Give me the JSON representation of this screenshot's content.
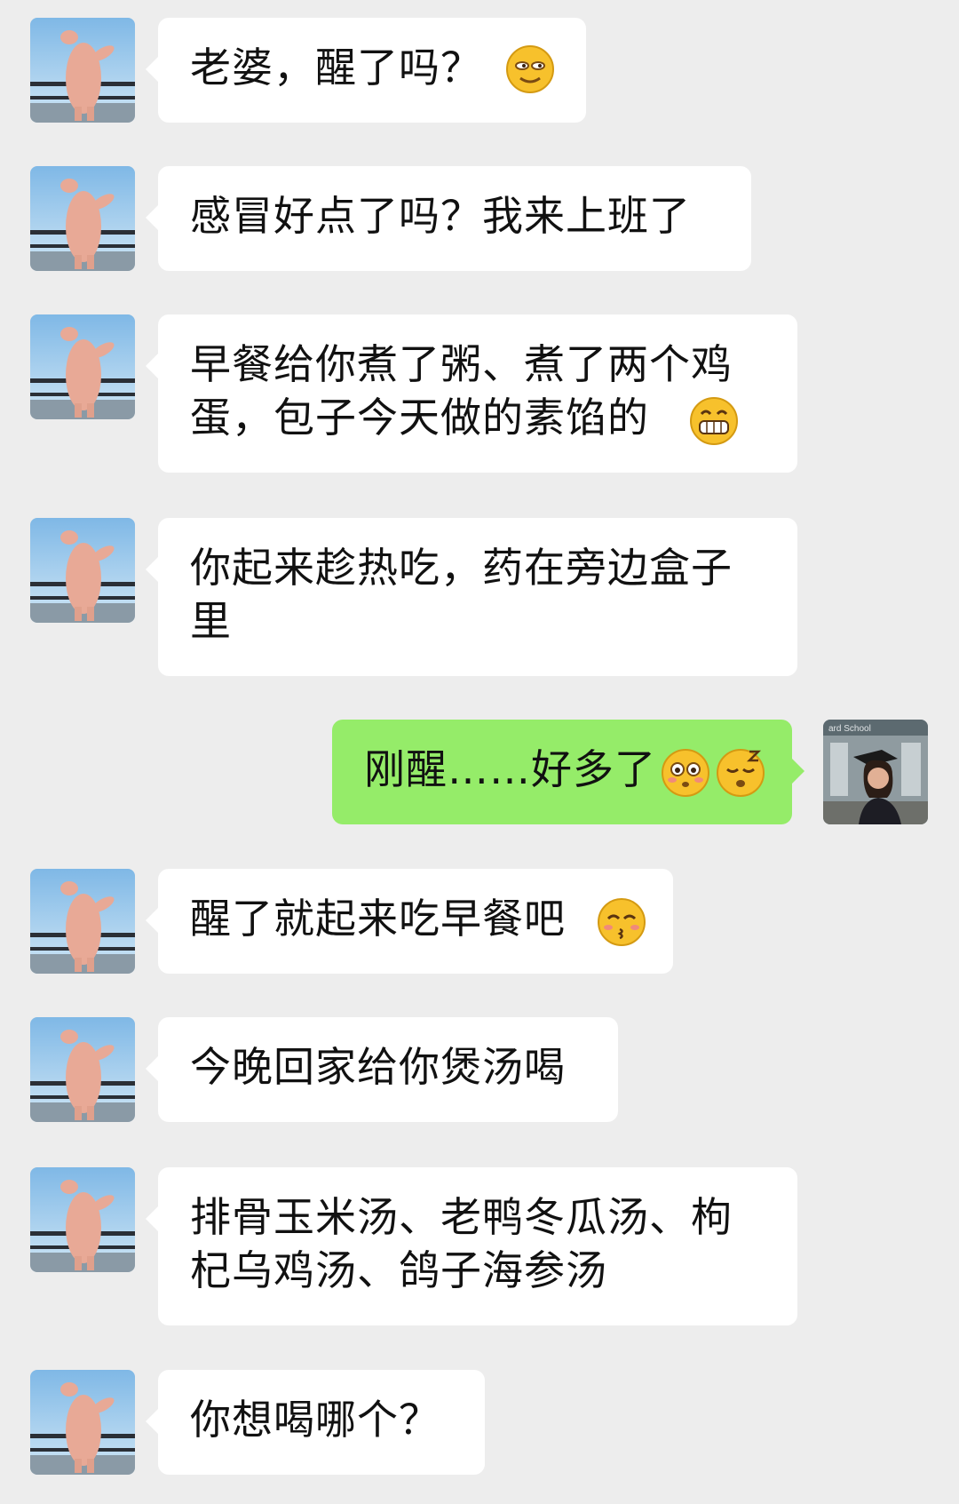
{
  "chat": {
    "messages": [
      {
        "sender": "other",
        "lines": [
          "老婆，醒了吗？"
        ],
        "emoji": [
          "smirk-face"
        ]
      },
      {
        "sender": "other",
        "lines": [
          "感冒好点了吗？我来上班了"
        ],
        "emoji": []
      },
      {
        "sender": "other",
        "lines": [
          "早餐给你煮了粥、煮了两个鸡",
          "蛋，包子今天做的素馅的"
        ],
        "emoji": [
          "grin-face"
        ]
      },
      {
        "sender": "other",
        "lines": [
          "你起来趁热吃，药在旁边盒子",
          "里"
        ],
        "emoji": []
      },
      {
        "sender": "self",
        "lines": [
          "刚醒……好多了"
        ],
        "emoji": [
          "blush-face",
          "sleepy-face"
        ]
      },
      {
        "sender": "other",
        "lines": [
          "醒了就起来吃早餐吧"
        ],
        "emoji": [
          "kiss-face"
        ]
      },
      {
        "sender": "other",
        "lines": [
          "今晚回家给你煲汤喝"
        ],
        "emoji": []
      },
      {
        "sender": "other",
        "lines": [
          "排骨玉米汤、老鸭冬瓜汤、枸",
          "杞乌鸡汤、鸽子海参汤"
        ],
        "emoji": []
      },
      {
        "sender": "other",
        "lines": [
          "你想喝哪个？"
        ],
        "emoji": []
      }
    ]
  },
  "avatars": {
    "other": {
      "icon": "pig-avatar-icon"
    },
    "self": {
      "icon": "graduate-avatar-icon",
      "sign_text": "ard School"
    }
  },
  "colors": {
    "background": "#ededed",
    "incoming_bubble": "#ffffff",
    "outgoing_bubble": "#95ec69",
    "text": "#111111"
  }
}
